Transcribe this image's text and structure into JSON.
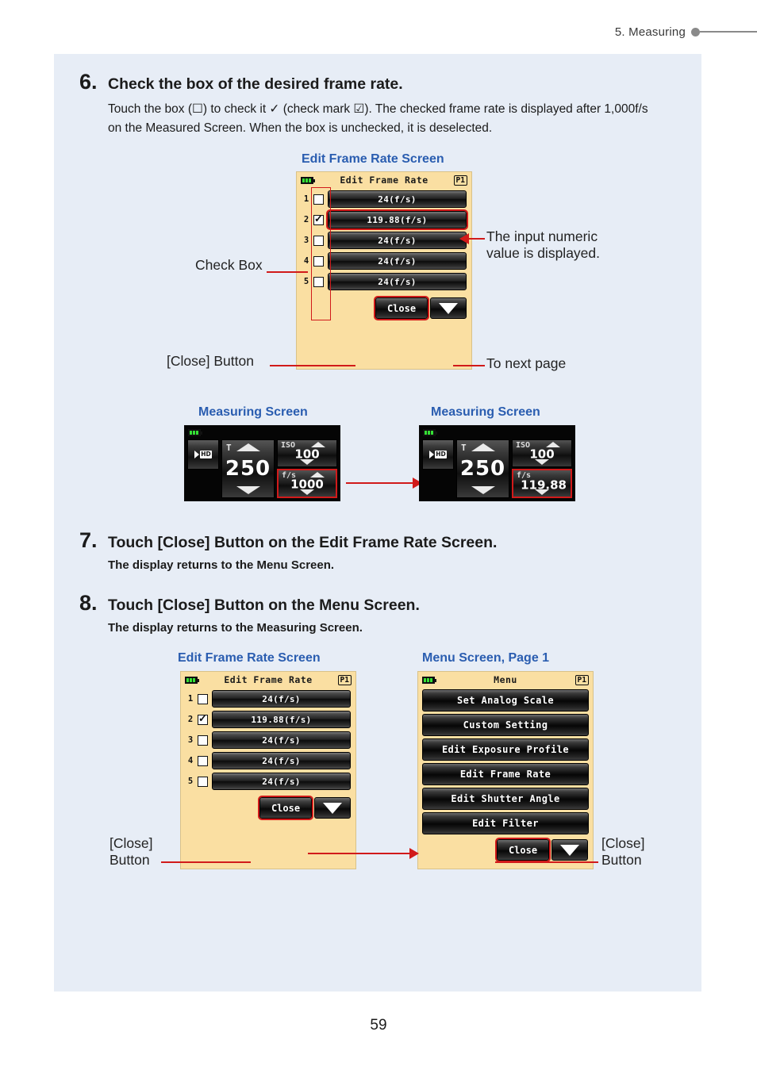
{
  "header": {
    "chapter_label": "5.  Measuring"
  },
  "footer": {
    "page_number": "59"
  },
  "steps": [
    {
      "number": "6.",
      "title": "Check the box of the desired frame rate.",
      "body": "Touch the box (☐) to check it ✓ (check mark ☑). The checked frame rate is displayed after 1,000f/s on the Measured Screen. When the box is unchecked, it is deselected."
    },
    {
      "number": "7.",
      "title": "Touch [Close] Button on the Edit Frame Rate Screen.",
      "body": "The display returns to the Menu Screen."
    },
    {
      "number": "8.",
      "title": "Touch [Close] Button on the Menu Screen.",
      "body": "The display returns to the Measuring Screen."
    }
  ],
  "captions": {
    "edit_frame_rate_screen_top": "Edit Frame Rate Screen",
    "measuring_screen_left": "Measuring Screen",
    "measuring_screen_right": "Measuring Screen",
    "edit_frame_rate_screen_bottom": "Edit Frame Rate Screen",
    "menu_screen_page1": "Menu Screen, Page 1"
  },
  "annotations": {
    "check_box": "Check Box",
    "close_button_top": "[Close] Button",
    "input_numeric": "The input numeric\nvalue is displayed.",
    "to_next_page": "To next page",
    "close_button_bottom_left": "[Close]\nButton",
    "close_button_bottom_right": "[Close]\nButton"
  },
  "edit_frame_rate_screen": {
    "title": "Edit Frame Rate",
    "page_badge": "P1",
    "rows": [
      {
        "index": "1",
        "checked": false,
        "value": "24(f/s)",
        "selected": false
      },
      {
        "index": "2",
        "checked": true,
        "value": "119.88(f/s)",
        "selected": true
      },
      {
        "index": "3",
        "checked": false,
        "value": "24(f/s)",
        "selected": false
      },
      {
        "index": "4",
        "checked": false,
        "value": "24(f/s)",
        "selected": false
      },
      {
        "index": "5",
        "checked": false,
        "value": "24(f/s)",
        "selected": false
      }
    ],
    "close_label": "Close",
    "next_page_icon": "triangle-down-icon"
  },
  "menu_screen": {
    "title": "Menu",
    "page_badge": "P1",
    "items": [
      "Set Analog Scale",
      "Custom Setting",
      "Edit Exposure Profile",
      "Edit Frame Rate",
      "Edit Shutter Angle",
      "Edit Filter"
    ],
    "close_label": "Close",
    "next_page_icon": "triangle-down-icon"
  },
  "measuring_screen_before": {
    "mode_icon": "hd-video-icon",
    "hd_label": "HD",
    "t_label": "T",
    "t_value": "250",
    "iso_label": "ISO",
    "iso_value": "100",
    "fps_label": "f/s",
    "fps_value": "1000",
    "fps_highlighted": true
  },
  "measuring_screen_after": {
    "mode_icon": "hd-video-icon",
    "hd_label": "HD",
    "t_label": "T",
    "t_value": "250",
    "iso_label": "ISO",
    "iso_value": "100",
    "fps_label": "f/s",
    "fps_value": "119.88",
    "fps_highlighted": true
  },
  "colors": {
    "panel_bg": "#e7edf6",
    "caption_blue": "#2a5db0",
    "accent_red": "#d11a1a",
    "device_bg": "#fadfa2"
  }
}
